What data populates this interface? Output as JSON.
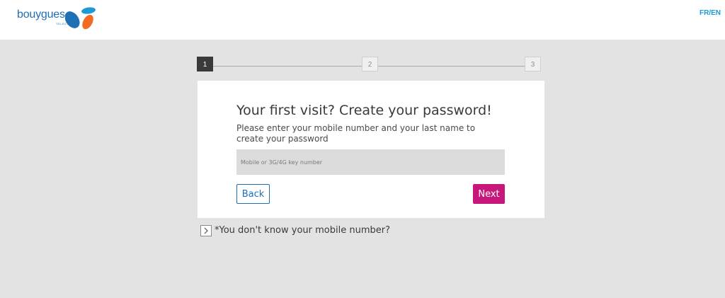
{
  "header": {
    "logo_text": "bouygues",
    "logo_sub": "TELECOM",
    "language_switch": "FR/EN"
  },
  "stepper": {
    "steps": [
      "1",
      "2",
      "3"
    ],
    "active_step": 1
  },
  "form": {
    "title": "Your first visit? Create your password!",
    "description": "Please enter your mobile number and your last name to create your password",
    "mobile_placeholder": "Mobile or 3G/4G key number",
    "mobile_value": "",
    "back_label": "Back",
    "next_label": "Next"
  },
  "help": {
    "link_text": "*You don't know your mobile number?"
  },
  "colors": {
    "brand_blue": "#1f6fb5",
    "accent_magenta": "#c8177a",
    "logo_orange": "#f26b21",
    "background_gray": "#e3e3e3"
  }
}
